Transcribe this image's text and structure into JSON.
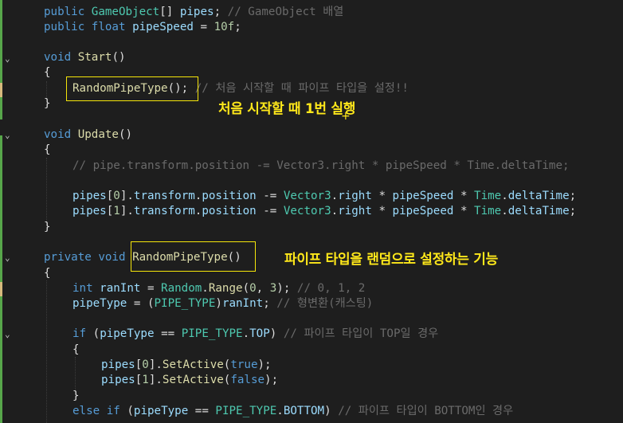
{
  "code": {
    "l1": [
      "public",
      " ",
      "GameObject",
      "[] ",
      "pipes",
      "; ",
      "// GameObject 배열"
    ],
    "l2": [
      "public",
      " ",
      "float",
      " ",
      "pipeSpeed",
      " = ",
      "10f",
      ";"
    ],
    "l3": [
      "void",
      " ",
      "Start",
      "()"
    ],
    "l4": "{",
    "l5": [
      "RandomPipeType",
      "();",
      " // 처음 시작할 때 파이프 타입을 설정!!"
    ],
    "l6": "}",
    "l7": [
      "void",
      " ",
      "Update",
      "()"
    ],
    "l8": "{",
    "l9": "// pipe.transform.position -= Vector3.right * pipeSpeed * Time.deltaTime;",
    "l10": [
      "pipes",
      "[",
      "0",
      "].",
      "transform",
      ".",
      "position",
      " -= ",
      "Vector3",
      ".",
      "right",
      " * ",
      "pipeSpeed",
      " * ",
      "Time",
      ".",
      "deltaTime",
      ";"
    ],
    "l11": [
      "pipes",
      "[",
      "1",
      "].",
      "transform",
      ".",
      "position",
      " -= ",
      "Vector3",
      ".",
      "right",
      " * ",
      "pipeSpeed",
      " * ",
      "Time",
      ".",
      "deltaTime",
      ";"
    ],
    "l12": "}",
    "l13": [
      "private",
      " ",
      "void",
      " ",
      "RandomPipeType",
      "()"
    ],
    "l14": "{",
    "l15": [
      "int",
      " ",
      "ranInt",
      " = ",
      "Random",
      ".",
      "Range",
      "(",
      "0",
      ", ",
      "3",
      "); ",
      "// 0, 1, 2"
    ],
    "l16": [
      "pipeType",
      " = (",
      "PIPE_TYPE",
      ")",
      "ranInt",
      "; ",
      "// 형변환(캐스팅)"
    ],
    "l17": [
      "if",
      " (",
      "pipeType",
      " == ",
      "PIPE_TYPE",
      ".",
      "TOP",
      ") ",
      "// 파이프 타입이 TOP일 경우"
    ],
    "l18": "{",
    "l19": [
      "pipes",
      "[",
      "0",
      "].",
      "SetActive",
      "(",
      "true",
      ");"
    ],
    "l20": [
      "pipes",
      "[",
      "1",
      "].",
      "SetActive",
      "(",
      "false",
      ");"
    ],
    "l21": "}",
    "l22": [
      "else",
      " ",
      "if",
      " (",
      "pipeType",
      " == ",
      "PIPE_TYPE",
      ".",
      "BOTTOM",
      ") ",
      "// 파이프 타입이 BOTTOM인 경우"
    ]
  },
  "annotations": {
    "start_note": "처음 시작할 때 1번 실행",
    "random_note": "파이프 타입을 랜덤으로 설정하는 기능"
  },
  "colors": {
    "keyword": "#569cd6",
    "comment": "#57a64a",
    "highlight_box": "#f5e60a",
    "annotation_text": "#ffe81a",
    "change_bar": "#57a64a"
  }
}
